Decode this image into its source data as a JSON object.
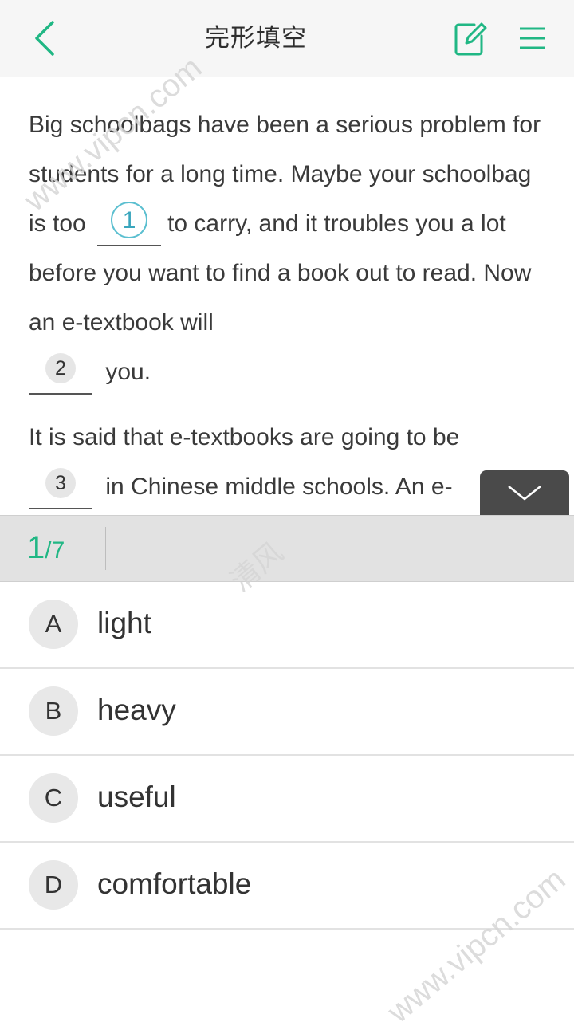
{
  "header": {
    "title": "完形填空",
    "back_icon": "chevron-left-icon",
    "edit_icon": "edit-icon",
    "menu_icon": "menu-icon"
  },
  "passage": {
    "p1_a": "Big schoolbags have been a serious problem for students for a long time. Maybe your schoolbag is too",
    "blank1": "1",
    "p1_b": "to carry, and it troubles you a lot before you want to find a book out to read. Now an e-textbook will",
    "blank2": "2",
    "p1_c": "you.",
    "p2_a": "It is said that e-textbooks are going to be",
    "blank3": "3",
    "p2_b": "in Chinese middle schools. An e-"
  },
  "progress": {
    "current": "1",
    "total": "/7"
  },
  "options": [
    {
      "letter": "A",
      "text": "light"
    },
    {
      "letter": "B",
      "text": "heavy"
    },
    {
      "letter": "C",
      "text": "useful"
    },
    {
      "letter": "D",
      "text": "comfortable"
    }
  ],
  "watermarks": {
    "w1": "www.vipcn.com",
    "w2": "清风",
    "w3": "www.vipcn.com"
  },
  "colors": {
    "accent": "#20b784",
    "active_blank": "#5bbfd0"
  }
}
